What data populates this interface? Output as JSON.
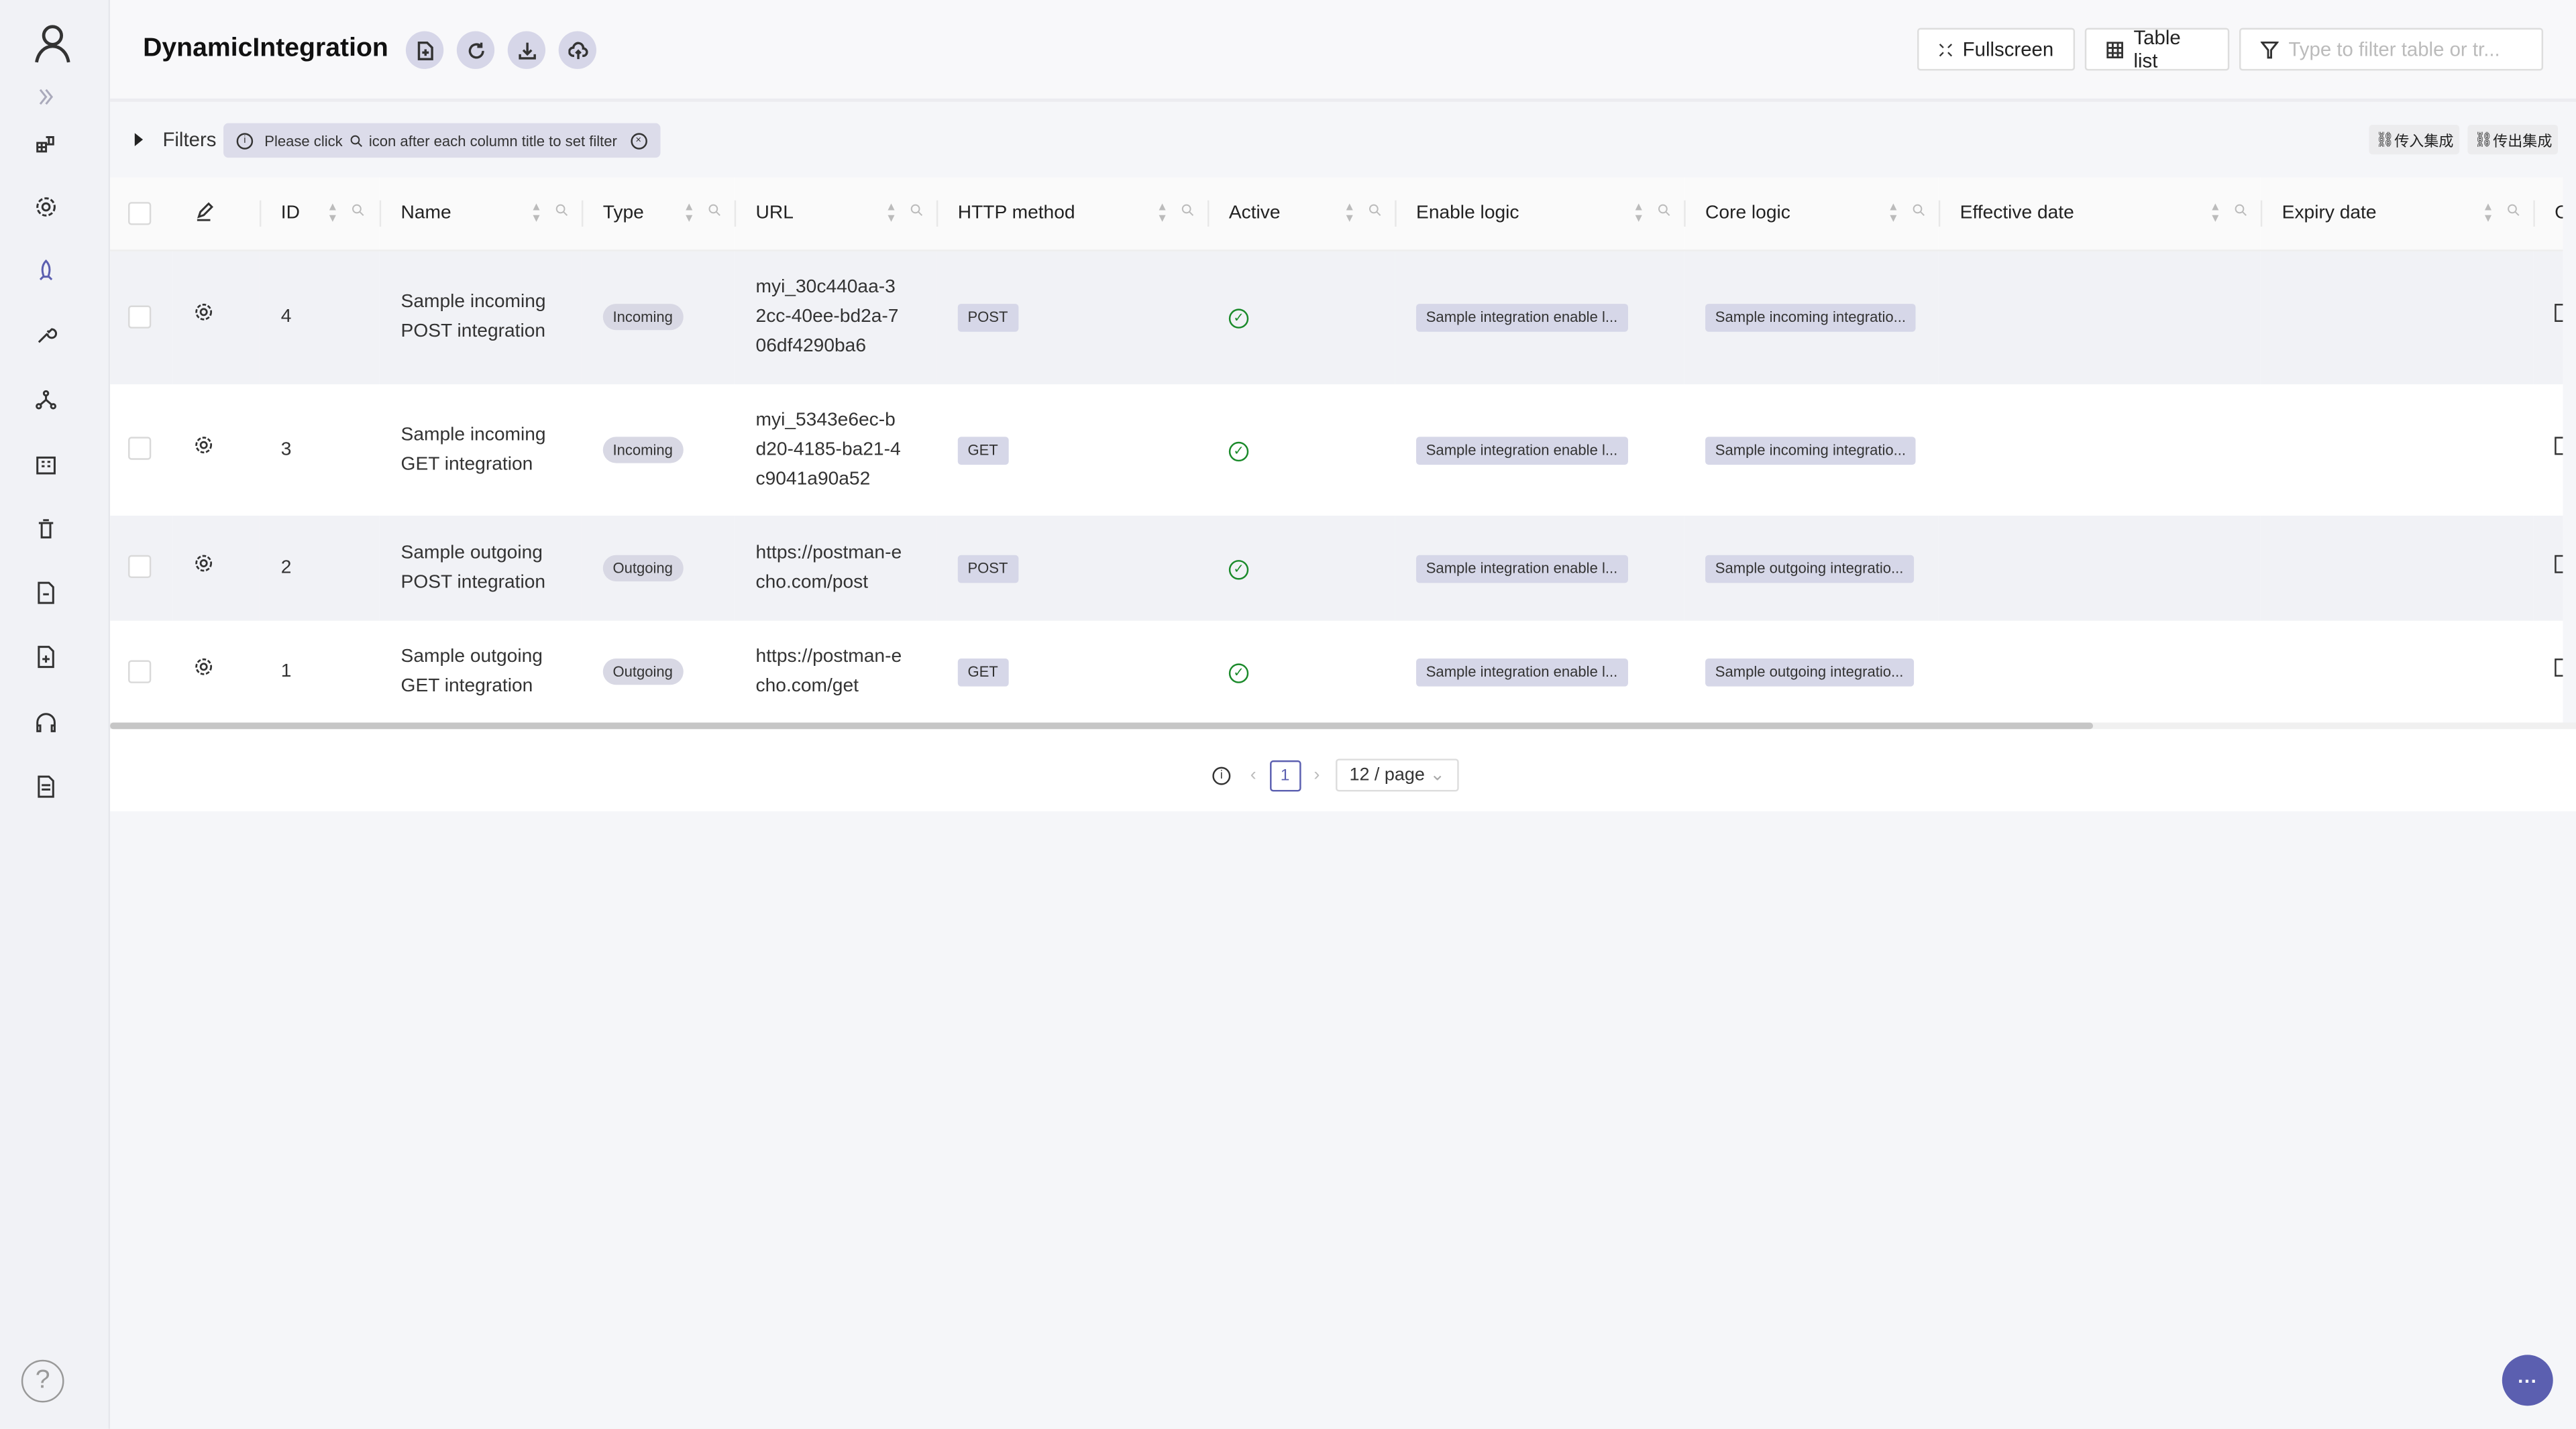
{
  "app": {
    "title": "DynamicIntegration"
  },
  "header": {
    "fullscreen_label": "Fullscreen",
    "table_list_label": "Table list",
    "filter_placeholder": "Type to filter table or tr..."
  },
  "filters": {
    "label": "Filters",
    "hint_before": "Please click",
    "hint_after": "icon after each column title to set filter",
    "incoming_btn": "传入集成",
    "outgoing_btn": "传出集成"
  },
  "table": {
    "columns": [
      "ID",
      "Name",
      "Type",
      "URL",
      "HTTP method",
      "Active",
      "Enable logic",
      "Core logic",
      "Effective date",
      "Expiry date",
      "Ob"
    ],
    "rows": [
      {
        "id": "4",
        "name": "Sample incoming POST integration",
        "type": "Incoming",
        "url": "myi_30c440aa-32cc-40ee-bd2a-706df4290ba6",
        "method": "POST",
        "active": true,
        "enable": "Sample integration enable l...",
        "core": "Sample incoming integratio..."
      },
      {
        "id": "3",
        "name": "Sample incoming GET integration",
        "type": "Incoming",
        "url": "myi_5343e6ec-bd20-4185-ba21-4c9041a90a52",
        "method": "GET",
        "active": true,
        "enable": "Sample integration enable l...",
        "core": "Sample incoming integratio..."
      },
      {
        "id": "2",
        "name": "Sample outgoing POST integration",
        "type": "Outgoing",
        "url": "https://postman-echo.com/post",
        "method": "POST",
        "active": true,
        "enable": "Sample integration enable l...",
        "core": "Sample outgoing integratio..."
      },
      {
        "id": "1",
        "name": "Sample outgoing GET integration",
        "type": "Outgoing",
        "url": "https://postman-echo.com/get",
        "method": "GET",
        "active": true,
        "enable": "Sample integration enable l...",
        "core": "Sample outgoing integratio..."
      }
    ]
  },
  "pagination": {
    "current_page": "1",
    "page_size": "12 / page"
  },
  "colors": {
    "accent": "#5b5fb0",
    "active_check": "#1a8a2a",
    "tag_bg": "#d6d7e8"
  }
}
